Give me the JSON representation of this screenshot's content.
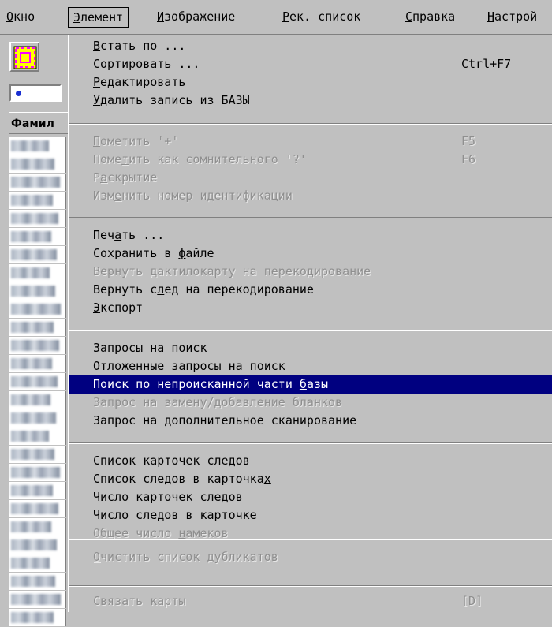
{
  "menubar": {
    "items": [
      {
        "label": "Окно",
        "ul": "О",
        "rest": "кно"
      },
      {
        "label": "Элемент",
        "ul": "Э",
        "rest": "лемент"
      },
      {
        "label": "Изображение",
        "ul": "И",
        "rest": "зображение"
      },
      {
        "label": "Рек. список",
        "ul": "Р",
        "rest": "ек. список"
      },
      {
        "label": "Справка",
        "ul": "С",
        "rest": "правка"
      },
      {
        "label": "Настрой",
        "ul": "Н",
        "rest": "астрой"
      }
    ],
    "active_index": 1
  },
  "left_pane": {
    "column_header": "Фамил"
  },
  "dropdown": {
    "sections": [
      [
        {
          "pre": "",
          "ul": "В",
          "post": "стать по ...",
          "enabled": true
        },
        {
          "pre": "",
          "ul": "С",
          "post": "ортировать ...",
          "enabled": true,
          "shortcut": "Ctrl+F7"
        },
        {
          "pre": "",
          "ul": "Р",
          "post": "едактировать",
          "enabled": true
        },
        {
          "pre": "",
          "ul": "У",
          "post": "далить запись из БАЗЫ",
          "enabled": true
        }
      ],
      [
        {
          "pre": "",
          "ul": "П",
          "post": "ометить '+'",
          "enabled": false,
          "shortcut": "F5"
        },
        {
          "pre": "Поме",
          "ul": "т",
          "post": "ить как сомнительного '?'",
          "enabled": false,
          "shortcut": "F6"
        },
        {
          "pre": "Р",
          "ul": "а",
          "post": "скрытие",
          "enabled": false
        },
        {
          "pre": "Изм",
          "ul": "е",
          "post": "нить номер идентификации",
          "enabled": false
        }
      ],
      [
        {
          "pre": "Печ",
          "ul": "а",
          "post": "ть ...",
          "enabled": true
        },
        {
          "pre": "Сохранить в ",
          "ul": "ф",
          "post": "айле",
          "enabled": true
        },
        {
          "pre": "Вернуть дактилокарту на перекодирование",
          "ul": "",
          "post": "",
          "enabled": false
        },
        {
          "pre": "Вернуть с",
          "ul": "л",
          "post": "ед на перекодирование",
          "enabled": true
        },
        {
          "pre": "",
          "ul": "Э",
          "post": "кспорт",
          "enabled": true
        }
      ],
      [
        {
          "pre": "",
          "ul": "З",
          "post": "апросы на поиск",
          "enabled": true
        },
        {
          "pre": "Отло",
          "ul": "ж",
          "post": "енные запросы на поиск",
          "enabled": true
        },
        {
          "pre": "Поиск по непроисканной части ",
          "ul": "б",
          "post": "азы",
          "enabled": true,
          "highlight": true
        },
        {
          "pre": "Запрос на замену/добавление бланков",
          "ul": "",
          "post": "",
          "enabled": false
        },
        {
          "pre": "Запрос на ",
          "ul": "д",
          "post": "ополнительное сканирование",
          "enabled": true
        }
      ],
      [
        {
          "pre": "Список карточек следов",
          "ul": "",
          "post": "",
          "enabled": true
        },
        {
          "pre": "Список следов в карточка",
          "ul": "х",
          "post": "",
          "enabled": true
        },
        {
          "pre": "Число карточек следов",
          "ul": "",
          "post": "",
          "enabled": true
        },
        {
          "pre": "Число следов в карточке",
          "ul": "",
          "post": "",
          "enabled": true
        },
        {
          "pre": "Общее число ",
          "ul": "н",
          "post": "амеков",
          "enabled": false
        }
      ],
      [
        {
          "pre": "",
          "ul": "О",
          "post": "чистить список дубликатов",
          "enabled": false
        }
      ],
      [
        {
          "pre": "Связать карты",
          "ul": "",
          "post": "",
          "enabled": false,
          "shortcut": "[D]"
        }
      ]
    ]
  },
  "colors": {
    "face": "#c0c0c0",
    "highlight": "#000080",
    "disabled_text": "#8f8f8f"
  }
}
